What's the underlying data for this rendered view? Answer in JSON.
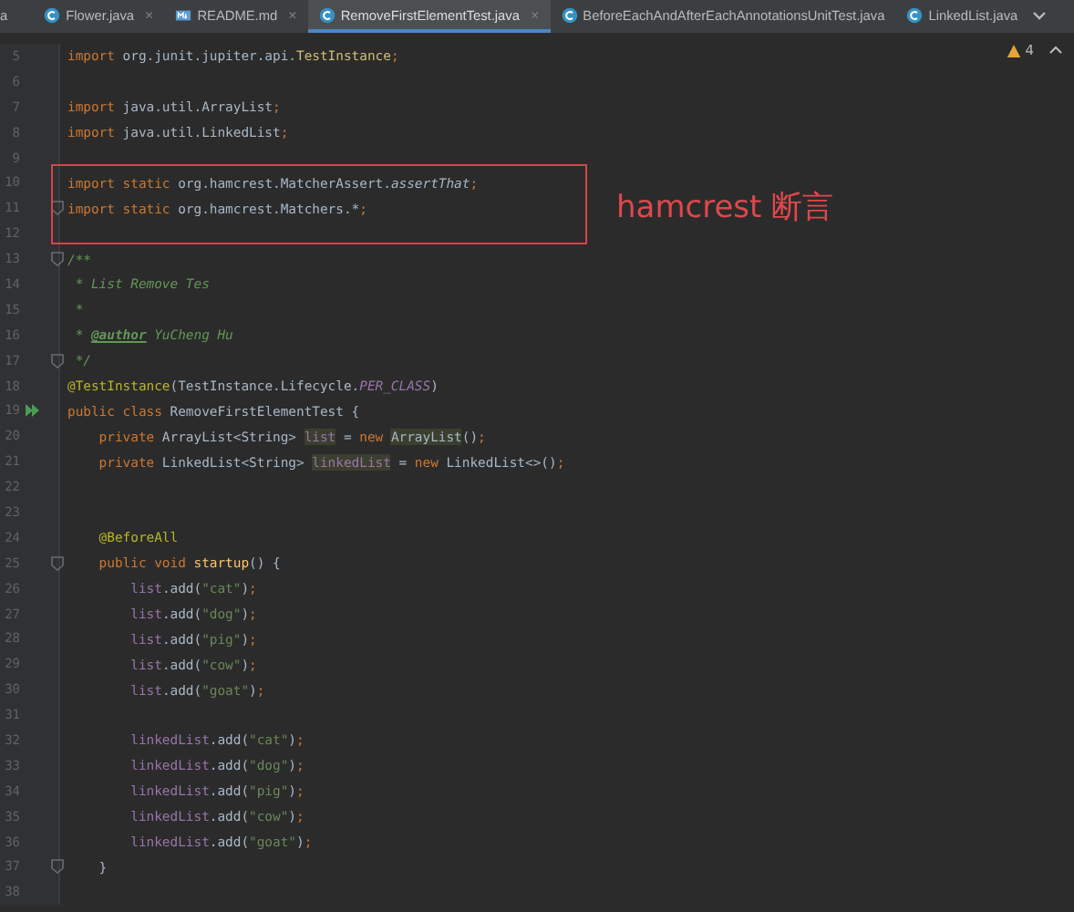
{
  "tabs": [
    {
      "label": "a",
      "kind": "cut",
      "selected": false
    },
    {
      "label": "Flower.java",
      "kind": "class",
      "close": "×",
      "selected": false
    },
    {
      "label": "README.md",
      "kind": "markdown",
      "close": "×",
      "selected": false
    },
    {
      "label": "RemoveFirstElementTest.java",
      "kind": "class",
      "close": "×",
      "selected": true
    },
    {
      "label": "BeforeEachAndAfterEachAnnotationsUnitTest.java",
      "kind": "class",
      "selected": false
    },
    {
      "label": "LinkedList.java",
      "kind": "class",
      "selected": false
    }
  ],
  "inspection": {
    "count": "4"
  },
  "editor": {
    "lines": [
      {
        "number": "5",
        "tokens": [
          {
            "kind": "keyword",
            "text": "import"
          },
          {
            "kind": "plain",
            "text": " org.junit.jupiter.api."
          },
          {
            "kind": "class",
            "text": "TestInstance"
          },
          {
            "kind": "keyword",
            "text": ";"
          }
        ]
      },
      {
        "number": "6"
      },
      {
        "number": "7",
        "tokens": [
          {
            "kind": "keyword",
            "text": "import"
          },
          {
            "kind": "plain",
            "text": " java.util.ArrayList"
          },
          {
            "kind": "keyword",
            "text": ";"
          }
        ]
      },
      {
        "number": "8",
        "tokens": [
          {
            "kind": "keyword",
            "text": "import"
          },
          {
            "kind": "plain",
            "text": " java.util.LinkedList"
          },
          {
            "kind": "keyword",
            "text": ";"
          }
        ]
      },
      {
        "number": "9"
      },
      {
        "number": "10",
        "tokens": [
          {
            "kind": "keyword",
            "text": "import static"
          },
          {
            "kind": "plain",
            "text": " org.hamcrest.MatcherAssert."
          },
          {
            "kind": "static-method",
            "text": "assertThat"
          },
          {
            "kind": "keyword",
            "text": ";"
          }
        ]
      },
      {
        "number": "11",
        "kind": "fold",
        "tokens": [
          {
            "kind": "keyword",
            "text": "import static"
          },
          {
            "kind": "plain",
            "text": " org.hamcrest.Matchers.*"
          },
          {
            "kind": "keyword",
            "text": ";"
          }
        ]
      },
      {
        "number": "12"
      },
      {
        "number": "13",
        "kind": "fold",
        "tokens": [
          {
            "kind": "comment",
            "text": "/**"
          }
        ]
      },
      {
        "number": "14",
        "tokens": [
          {
            "kind": "comment",
            "text": " * List Remove Tes"
          }
        ]
      },
      {
        "number": "15",
        "tokens": [
          {
            "kind": "comment",
            "text": " *"
          }
        ]
      },
      {
        "number": "16",
        "tokens": [
          {
            "kind": "comment",
            "text": " * "
          },
          {
            "kind": "doc-tag",
            "text": "@author"
          },
          {
            "kind": "comment",
            "text": " YuCheng Hu"
          }
        ]
      },
      {
        "number": "17",
        "kind": "fold",
        "tokens": [
          {
            "kind": "comment",
            "text": " */"
          }
        ]
      },
      {
        "number": "18",
        "tokens": [
          {
            "kind": "annotation",
            "text": "@TestInstance"
          },
          {
            "kind": "plain",
            "text": "(TestInstance.Lifecycle."
          },
          {
            "kind": "constant",
            "text": "PER_CLASS"
          },
          {
            "kind": "plain",
            "text": ")"
          }
        ]
      },
      {
        "number": "19",
        "kind": "run",
        "tokens": [
          {
            "kind": "keyword",
            "text": "public class"
          },
          {
            "kind": "plain",
            "text": " RemoveFirstElementTest {"
          }
        ]
      },
      {
        "number": "20",
        "tokens": [
          {
            "kind": "keyword",
            "text": "    private"
          },
          {
            "kind": "plain",
            "text": " ArrayList<String> "
          },
          {
            "kind": "field-highlight",
            "text": "list"
          },
          {
            "kind": "plain",
            "text": " = "
          },
          {
            "kind": "keyword",
            "text": "new "
          },
          {
            "kind": "class-highlight",
            "text": "ArrayList"
          },
          {
            "kind": "plain",
            "text": "()"
          },
          {
            "kind": "keyword",
            "text": ";"
          }
        ]
      },
      {
        "number": "21",
        "tokens": [
          {
            "kind": "keyword",
            "text": "    private"
          },
          {
            "kind": "plain",
            "text": " LinkedList<String> "
          },
          {
            "kind": "field-highlight",
            "text": "linkedList"
          },
          {
            "kind": "plain",
            "text": " = "
          },
          {
            "kind": "keyword",
            "text": "new"
          },
          {
            "kind": "plain",
            "text": " LinkedList<>()"
          },
          {
            "kind": "keyword",
            "text": ";"
          }
        ]
      },
      {
        "number": "22"
      },
      {
        "number": "23"
      },
      {
        "number": "24",
        "tokens": [
          {
            "kind": "annotation",
            "text": "    @BeforeAll"
          }
        ]
      },
      {
        "number": "25",
        "kind": "fold",
        "tokens": [
          {
            "kind": "keyword",
            "text": "    public void"
          },
          {
            "kind": "method",
            "text": " startup"
          },
          {
            "kind": "plain",
            "text": "() {"
          }
        ]
      },
      {
        "number": "26",
        "tokens": [
          {
            "kind": "field",
            "text": "        list"
          },
          {
            "kind": "plain",
            "text": ".add("
          },
          {
            "kind": "string",
            "text": "\"cat\""
          },
          {
            "kind": "plain",
            "text": ")"
          },
          {
            "kind": "keyword",
            "text": ";"
          }
        ]
      },
      {
        "number": "27",
        "tokens": [
          {
            "kind": "field",
            "text": "        list"
          },
          {
            "kind": "plain",
            "text": ".add("
          },
          {
            "kind": "string",
            "text": "\"dog\""
          },
          {
            "kind": "plain",
            "text": ")"
          },
          {
            "kind": "keyword",
            "text": ";"
          }
        ]
      },
      {
        "number": "28",
        "tokens": [
          {
            "kind": "field",
            "text": "        list"
          },
          {
            "kind": "plain",
            "text": ".add("
          },
          {
            "kind": "string",
            "text": "\"pig\""
          },
          {
            "kind": "plain",
            "text": ")"
          },
          {
            "kind": "keyword",
            "text": ";"
          }
        ]
      },
      {
        "number": "29",
        "tokens": [
          {
            "kind": "field",
            "text": "        list"
          },
          {
            "kind": "plain",
            "text": ".add("
          },
          {
            "kind": "string",
            "text": "\"cow\""
          },
          {
            "kind": "plain",
            "text": ")"
          },
          {
            "kind": "keyword",
            "text": ";"
          }
        ]
      },
      {
        "number": "30",
        "tokens": [
          {
            "kind": "field",
            "text": "        list"
          },
          {
            "kind": "plain",
            "text": ".add("
          },
          {
            "kind": "string",
            "text": "\"goat\""
          },
          {
            "kind": "plain",
            "text": ")"
          },
          {
            "kind": "keyword",
            "text": ";"
          }
        ]
      },
      {
        "number": "31"
      },
      {
        "number": "32",
        "tokens": [
          {
            "kind": "field",
            "text": "        linkedList"
          },
          {
            "kind": "plain",
            "text": ".add("
          },
          {
            "kind": "string",
            "text": "\"cat\""
          },
          {
            "kind": "plain",
            "text": ")"
          },
          {
            "kind": "keyword",
            "text": ";"
          }
        ]
      },
      {
        "number": "33",
        "tokens": [
          {
            "kind": "field",
            "text": "        linkedList"
          },
          {
            "kind": "plain",
            "text": ".add("
          },
          {
            "kind": "string",
            "text": "\"dog\""
          },
          {
            "kind": "plain",
            "text": ")"
          },
          {
            "kind": "keyword",
            "text": ";"
          }
        ]
      },
      {
        "number": "34",
        "tokens": [
          {
            "kind": "field",
            "text": "        linkedList"
          },
          {
            "kind": "plain",
            "text": ".add("
          },
          {
            "kind": "string",
            "text": "\"pig\""
          },
          {
            "kind": "plain",
            "text": ")"
          },
          {
            "kind": "keyword",
            "text": ";"
          }
        ]
      },
      {
        "number": "35",
        "tokens": [
          {
            "kind": "field",
            "text": "        linkedList"
          },
          {
            "kind": "plain",
            "text": ".add("
          },
          {
            "kind": "string",
            "text": "\"cow\""
          },
          {
            "kind": "plain",
            "text": ")"
          },
          {
            "kind": "keyword",
            "text": ";"
          }
        ]
      },
      {
        "number": "36",
        "tokens": [
          {
            "kind": "field",
            "text": "        linkedList"
          },
          {
            "kind": "plain",
            "text": ".add("
          },
          {
            "kind": "string",
            "text": "\"goat\""
          },
          {
            "kind": "plain",
            "text": ")"
          },
          {
            "kind": "keyword",
            "text": ";"
          }
        ]
      },
      {
        "number": "37",
        "kind": "fold",
        "tokens": [
          {
            "kind": "plain",
            "text": "    }"
          }
        ]
      },
      {
        "number": "38"
      }
    ]
  },
  "annotation": {
    "label": "hamcrest 断言"
  }
}
